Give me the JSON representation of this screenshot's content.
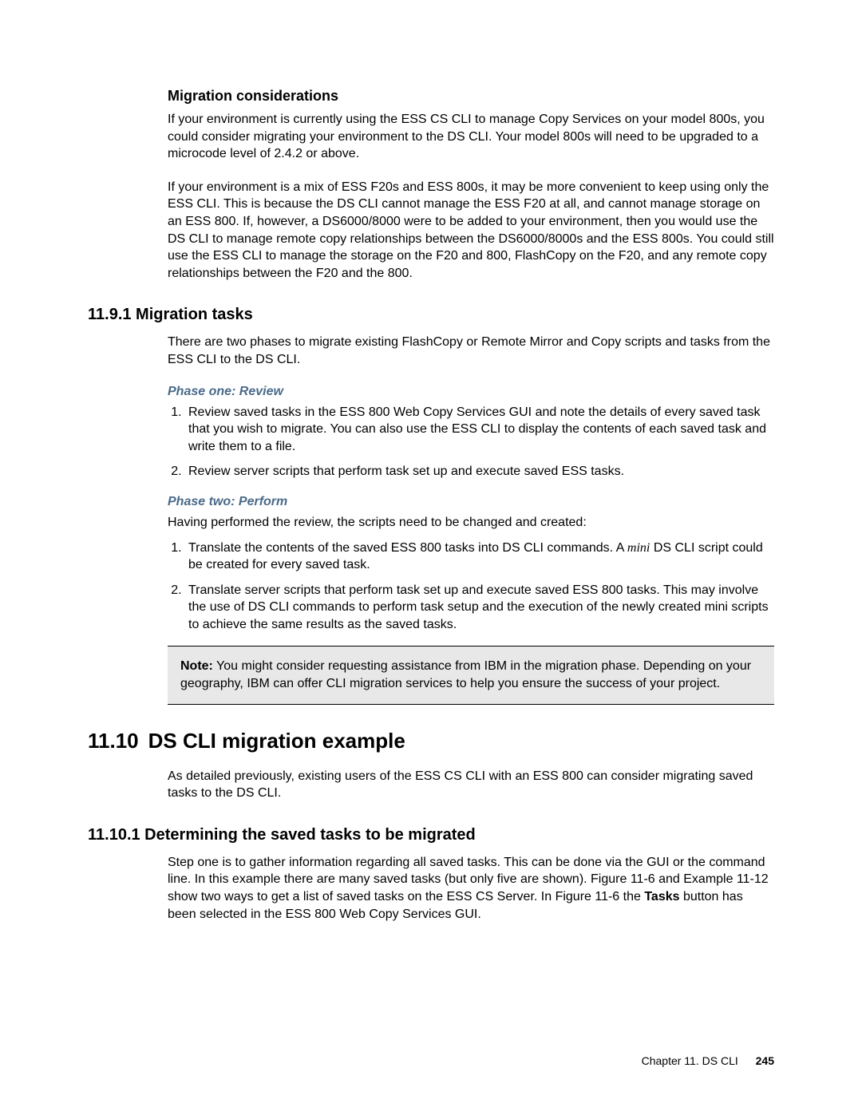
{
  "sec_migration_considerations": {
    "heading": "Migration considerations",
    "para1": "If your environment is currently using the ESS CS CLI to manage Copy Services on your model 800s, you could consider migrating your environment to the DS CLI. Your model 800s will need to be upgraded to a microcode level of 2.4.2 or above.",
    "para2": "If your environment is a mix of ESS F20s and ESS 800s, it may be more convenient to keep using only the ESS CLI. This is because the DS CLI cannot manage the ESS F20 at all, and cannot manage storage on an ESS 800. If, however, a DS6000/8000 were to be added to your environment, then you would use the DS CLI to manage remote copy relationships between the DS6000/8000s and the ESS 800s. You could still use the ESS CLI to manage the storage on the F20 and 800, FlashCopy on the F20, and any remote copy relationships between the F20 and the 800."
  },
  "sec_11_9_1": {
    "heading": "11.9.1  Migration tasks",
    "para1": "There are two phases to migrate existing FlashCopy or Remote Mirror and Copy scripts and tasks from the ESS CLI to the DS CLI.",
    "phase1_heading": "Phase one: Review",
    "phase1_items": {
      "i1": "Review saved tasks in the ESS 800 Web Copy Services GUI and note the details of every saved task that you wish to migrate. You can also use the ESS CLI to display the contents of each saved task and write them to a file.",
      "i2": "Review server scripts that perform task set up and execute saved ESS tasks."
    },
    "phase2_heading": "Phase two: Perform",
    "phase2_intro": "Having performed the review, the scripts need to be changed and created:",
    "phase2_items": {
      "i1_pre": "Translate the contents of the saved ESS 800 tasks into DS CLI commands. A ",
      "i1_mini": "mini",
      "i1_post": " DS CLI script could be created for every saved task.",
      "i2": "Translate server scripts that perform task set up and execute saved ESS 800 tasks. This may involve the use of DS CLI commands to perform task setup and the execution of the newly created mini scripts to achieve the same results as the saved tasks."
    },
    "note_label": "Note:",
    "note_text": " You might consider requesting assistance from IBM in the migration phase. Depending on your geography, IBM can offer CLI migration services to help you ensure the success of your project."
  },
  "sec_11_10": {
    "num": "11.10",
    "title": "DS CLI migration example",
    "para1": "As detailed previously, existing users of the ESS CS CLI with an ESS 800 can consider migrating saved tasks to the DS CLI."
  },
  "sec_11_10_1": {
    "heading": "11.10.1  Determining the saved tasks to be migrated",
    "para_pre": "Step one is to gather information regarding all saved tasks. This can be done via the GUI or the command line. In this example there are many saved tasks (but only five are shown). Figure 11-6 and Example 11-12 show two ways to get a list of saved tasks on the ESS CS Server. In Figure 11-6 the ",
    "tasks_word": "Tasks",
    "para_post": " button has been selected in the ESS 800 Web Copy Services GUI."
  },
  "footer": {
    "chapter_ref": "Chapter 11. DS CLI",
    "page_number": "245"
  }
}
